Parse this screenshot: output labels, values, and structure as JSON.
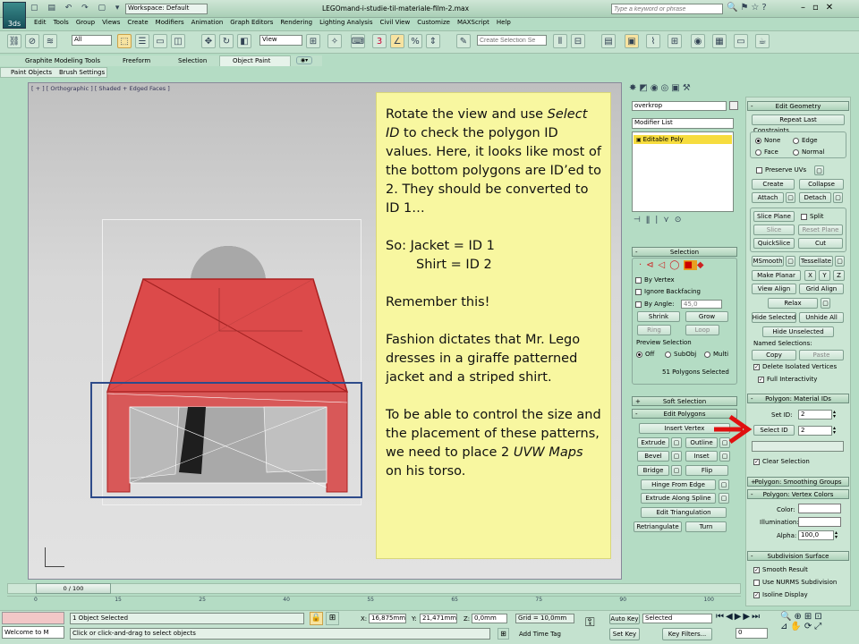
{
  "app": {
    "workspace": "Workspace: Default",
    "title": "LEGOmand-i-studie-til-materiale-film-2.max",
    "search_placeholder": "Type a keyword or phrase",
    "logo": "3ds-max-logo-icon"
  },
  "menu": [
    "Edit",
    "Tools",
    "Group",
    "Views",
    "Create",
    "Modifiers",
    "Animation",
    "Graph Editors",
    "Rendering",
    "Lighting Analysis",
    "Civil View",
    "Customize",
    "MAXScript",
    "Help"
  ],
  "toolbar": {
    "selection_filter": "All",
    "ref_coord": "View",
    "named_sel_placeholder": "Create Selection Se"
  },
  "ribbon": {
    "tabs": [
      "Graphite Modeling Tools",
      "Freeform",
      "Selection",
      "Object Paint"
    ],
    "subtabs": [
      "Paint Objects",
      "Brush Settings"
    ]
  },
  "viewport": {
    "label": "[ + ] [ Orthographic ] [ Shaded + Edged Faces ]",
    "time": "0 / 100",
    "ruler": [
      "0",
      "15",
      "25",
      "40",
      "55",
      "65",
      "75",
      "90",
      "100"
    ]
  },
  "callout": {
    "p1_a": "Rotate the view and use ",
    "p1_em": "Select ID",
    "p1_b": " to check the polygon ID values. Here, it looks like most of the bottom polygons are ID’ed to 2. They should be converted to ID 1…",
    "p2_l1": "So: Jacket = ID 1",
    "p2_l2": "Shirt   = ID 2",
    "p3": "Remember this!",
    "p4": "Fashion dictates that Mr. Lego dresses in a giraffe patterned jacket and a striped shirt.",
    "p5_a": "To be able to control the size and the placement of these patterns, we need to place 2 ",
    "p5_em": "UVW Maps",
    "p5_b": " on his torso."
  },
  "modifier": {
    "object_name": "overkrop",
    "list_label": "Modifier List",
    "stack_item": "Editable Poly"
  },
  "selection": {
    "title": "Selection",
    "by_vertex": "By Vertex",
    "ignore_backfacing": "Ignore Backfacing",
    "by_angle": "By Angle:",
    "angle_value": "45,0",
    "shrink": "Shrink",
    "grow": "Grow",
    "ring": "Ring",
    "loop": "Loop",
    "preview_title": "Preview Selection",
    "off": "Off",
    "subobj": "SubObj",
    "multi": "Multi",
    "status": "51 Polygons Selected"
  },
  "soft_selection": {
    "title": "Soft Selection"
  },
  "edit_polygons": {
    "title": "Edit Polygons",
    "insert_vertex": "Insert Vertex",
    "extrude": "Extrude",
    "outline": "Outline",
    "bevel": "Bevel",
    "inset": "Inset",
    "bridge": "Bridge",
    "flip": "Flip",
    "hinge": "Hinge From Edge",
    "extrude_spline": "Extrude Along Spline",
    "edit_tri": "Edit Triangulation",
    "retriangulate": "Retriangulate",
    "turn": "Turn"
  },
  "edit_geometry": {
    "title": "Edit Geometry",
    "repeat_last": "Repeat Last",
    "constraints": "Constraints",
    "none": "None",
    "edge": "Edge",
    "face": "Face",
    "normal": "Normal",
    "preserve_uvs": "Preserve UVs",
    "create": "Create",
    "collapse": "Collapse",
    "attach": "Attach",
    "detach": "Detach",
    "slice_plane": "Slice Plane",
    "split": "Split",
    "slice": "Slice",
    "reset_plane": "Reset Plane",
    "quickslice": "QuickSlice",
    "cut": "Cut",
    "msmooth": "MSmooth",
    "tessellate": "Tessellate",
    "make_planar": "Make Planar",
    "x": "X",
    "y": "Y",
    "z": "Z",
    "view_align": "View Align",
    "grid_align": "Grid Align",
    "relax": "Relax",
    "hide_selected": "Hide Selected",
    "unhide_all": "Unhide All",
    "hide_unselected": "Hide Unselected",
    "named_selections": "Named Selections:",
    "copy": "Copy",
    "paste": "Paste",
    "delete_isolated": "Delete Isolated Vertices",
    "full_interactivity": "Full Interactivity"
  },
  "material_ids": {
    "title": "Polygon: Material IDs",
    "set_id": "Set ID:",
    "set_id_value": "2",
    "select_id": "Select ID",
    "select_id_value": "2",
    "clear_selection": "Clear Selection"
  },
  "smoothing": {
    "title": "Polygon: Smoothing Groups"
  },
  "vertex_colors": {
    "title": "Polygon: Vertex Colors",
    "color": "Color:",
    "illumination": "Illumination:",
    "alpha": "Alpha:",
    "alpha_value": "100,0"
  },
  "subdivision": {
    "title": "Subdivision Surface",
    "smooth_result": "Smooth Result",
    "nurms": "Use NURMS Subdivision",
    "isoline": "Isoline Display"
  },
  "status": {
    "welcome": "Welcome to M",
    "objects_selected": "1 Object Selected",
    "hint": "Click or click-and-drag to select objects",
    "x_label": "X:",
    "x_value": "16,875mm",
    "y_label": "Y:",
    "y_value": "21,471mm",
    "z_label": "Z:",
    "z_value": "0,0mm",
    "grid": "Grid = 10,0mm",
    "add_time_tag": "Add Time Tag",
    "auto_key": "Auto Key",
    "set_key": "Set Key",
    "key_mode": "Selected",
    "key_filters": "Key Filters...",
    "frame": "0"
  },
  "colors": {
    "bg": "#b4dcc4",
    "callout": "#f8f7a0",
    "jacket": "#dc4a4a",
    "arrow": "#e01010",
    "highlight_box": "#2e4b8a"
  }
}
